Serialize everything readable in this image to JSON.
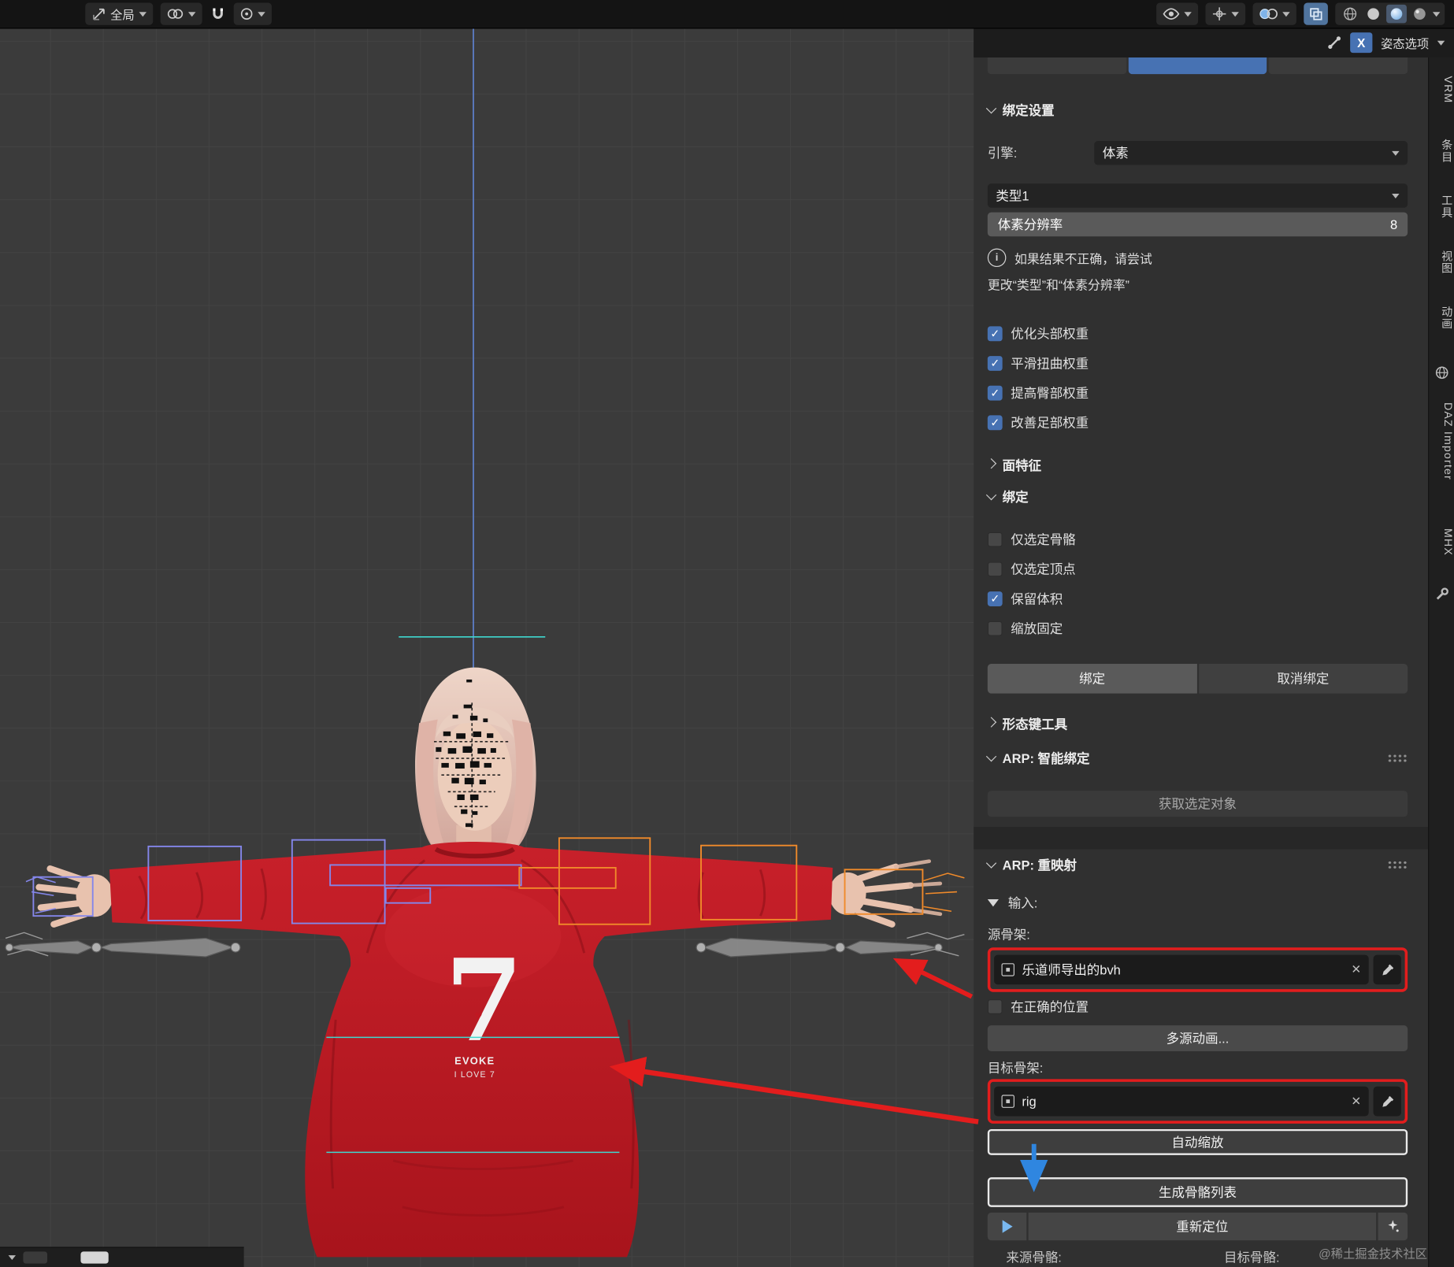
{
  "colors": {
    "accent_blue": "#4772b3",
    "annotation_red": "#e31d1d",
    "annotation_blue": "#2f86e0",
    "bone_orange": "#f08a2a",
    "bone_violet": "#8486ea",
    "axis_teal": "#3fd8cf",
    "sweater_red": "#bf1a22"
  },
  "topbar": {
    "orientation_label": "全局"
  },
  "subheader": {
    "xray_label": "X",
    "pose_options_label": "姿态选项"
  },
  "side_tabs": {
    "items": [
      {
        "label": "VRM"
      },
      {
        "label": "条目"
      },
      {
        "label": "工具"
      },
      {
        "label": "视图"
      },
      {
        "label": "动画"
      },
      {
        "label": "DAZ Importer"
      },
      {
        "label": "MHX"
      }
    ]
  },
  "panel": {
    "rig_settings": {
      "title": "绑定设置",
      "engine_label": "引擎:",
      "engine_value": "体素",
      "type_value": "类型1",
      "resolution_label": "体素分辨率",
      "resolution_value": "8",
      "info_line1": "如果结果不正确，请尝试",
      "info_line2": "更改“类型”和“体素分辨率”",
      "options": [
        {
          "label": "优化头部权重",
          "checked": true
        },
        {
          "label": "平滑扭曲权重",
          "checked": true
        },
        {
          "label": "提高臀部权重",
          "checked": true
        },
        {
          "label": "改善足部权重",
          "checked": true
        }
      ]
    },
    "face_features": {
      "title": "面特征"
    },
    "bind": {
      "title": "绑定",
      "options": [
        {
          "label": "仅选定骨骼",
          "checked": false
        },
        {
          "label": "仅选定顶点",
          "checked": false
        },
        {
          "label": "保留体积",
          "checked": true
        },
        {
          "label": "缩放固定",
          "checked": false
        }
      ],
      "bind_button": "绑定",
      "unbind_button": "取消绑定"
    },
    "shape_keys": {
      "title": "形态键工具"
    },
    "arp_smart": {
      "title": "ARP: 智能绑定",
      "get_selected_button": "获取选定对象"
    },
    "arp_remap": {
      "title": "ARP: 重映射",
      "input_label": "输入:",
      "source_label": "源骨架:",
      "source_value": "乐道师导出的bvh",
      "in_place_label": "在正确的位置",
      "multi_source_button": "多源动画...",
      "target_label": "目标骨架:",
      "target_value": "rig",
      "auto_scale_button": "自动缩放",
      "build_list_button": "生成骨骼列表",
      "retarget_button": "重新定位",
      "source_bones_label": "来源骨骼:",
      "target_bones_label": "目标骨骼:"
    }
  },
  "viewport": {
    "shirt_logo_number": "7",
    "shirt_logo_line1": "EVOKE",
    "shirt_logo_line2": "I LOVE 7"
  },
  "watermark": "@稀土掘金技术社区"
}
